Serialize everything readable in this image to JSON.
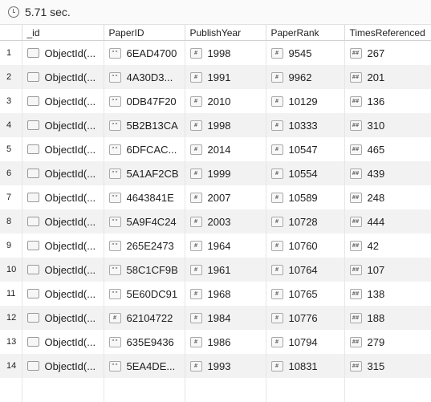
{
  "toolbar": {
    "elapsed_label": "5.71 sec."
  },
  "columns": [
    "_id",
    "PaperID",
    "PublishYear",
    "PaperRank",
    "TimesReferenced"
  ],
  "type_glyphs": {
    "string": "\"\"",
    "int32": "#",
    "int64": "##"
  },
  "rows": [
    {
      "n": "1",
      "id": "ObjectId(...",
      "pid": "6EAD4700",
      "pid_type": "\"\"",
      "year": "1998",
      "rank": "9545",
      "refs": "267"
    },
    {
      "n": "2",
      "id": "ObjectId(...",
      "pid": "4A30D3...",
      "pid_type": "\"\"",
      "year": "1991",
      "rank": "9962",
      "refs": "201"
    },
    {
      "n": "3",
      "id": "ObjectId(...",
      "pid": "0DB47F20",
      "pid_type": "\"\"",
      "year": "2010",
      "rank": "10129",
      "refs": "136"
    },
    {
      "n": "4",
      "id": "ObjectId(...",
      "pid": "5B2B13CA",
      "pid_type": "\"\"",
      "year": "1998",
      "rank": "10333",
      "refs": "310"
    },
    {
      "n": "5",
      "id": "ObjectId(...",
      "pid": "6DFCAC...",
      "pid_type": "\"\"",
      "year": "2014",
      "rank": "10547",
      "refs": "465"
    },
    {
      "n": "6",
      "id": "ObjectId(...",
      "pid": "5A1AF2CB",
      "pid_type": "\"\"",
      "year": "1999",
      "rank": "10554",
      "refs": "439"
    },
    {
      "n": "7",
      "id": "ObjectId(...",
      "pid": "4643841E",
      "pid_type": "\"\"",
      "year": "2007",
      "rank": "10589",
      "refs": "248"
    },
    {
      "n": "8",
      "id": "ObjectId(...",
      "pid": "5A9F4C24",
      "pid_type": "\"\"",
      "year": "2003",
      "rank": "10728",
      "refs": "444"
    },
    {
      "n": "9",
      "id": "ObjectId(...",
      "pid": "265E2473",
      "pid_type": "\"\"",
      "year": "1964",
      "rank": "10760",
      "refs": "42"
    },
    {
      "n": "10",
      "id": "ObjectId(...",
      "pid": "58C1CF9B",
      "pid_type": "\"\"",
      "year": "1961",
      "rank": "10764",
      "refs": "107"
    },
    {
      "n": "11",
      "id": "ObjectId(...",
      "pid": "5E60DC91",
      "pid_type": "\"\"",
      "year": "1968",
      "rank": "10765",
      "refs": "138"
    },
    {
      "n": "12",
      "id": "ObjectId(...",
      "pid": "62104722",
      "pid_type": "#",
      "year": "1984",
      "rank": "10776",
      "refs": "188"
    },
    {
      "n": "13",
      "id": "ObjectId(...",
      "pid": "635E9436",
      "pid_type": "\"\"",
      "year": "1986",
      "rank": "10794",
      "refs": "279"
    },
    {
      "n": "14",
      "id": "ObjectId(...",
      "pid": "5EA4DE...",
      "pid_type": "\"\"",
      "year": "1993",
      "rank": "10831",
      "refs": "315"
    },
    {
      "n": "",
      "id": "",
      "pid": "",
      "pid_type": "",
      "year": "",
      "rank": "",
      "refs": ""
    }
  ]
}
